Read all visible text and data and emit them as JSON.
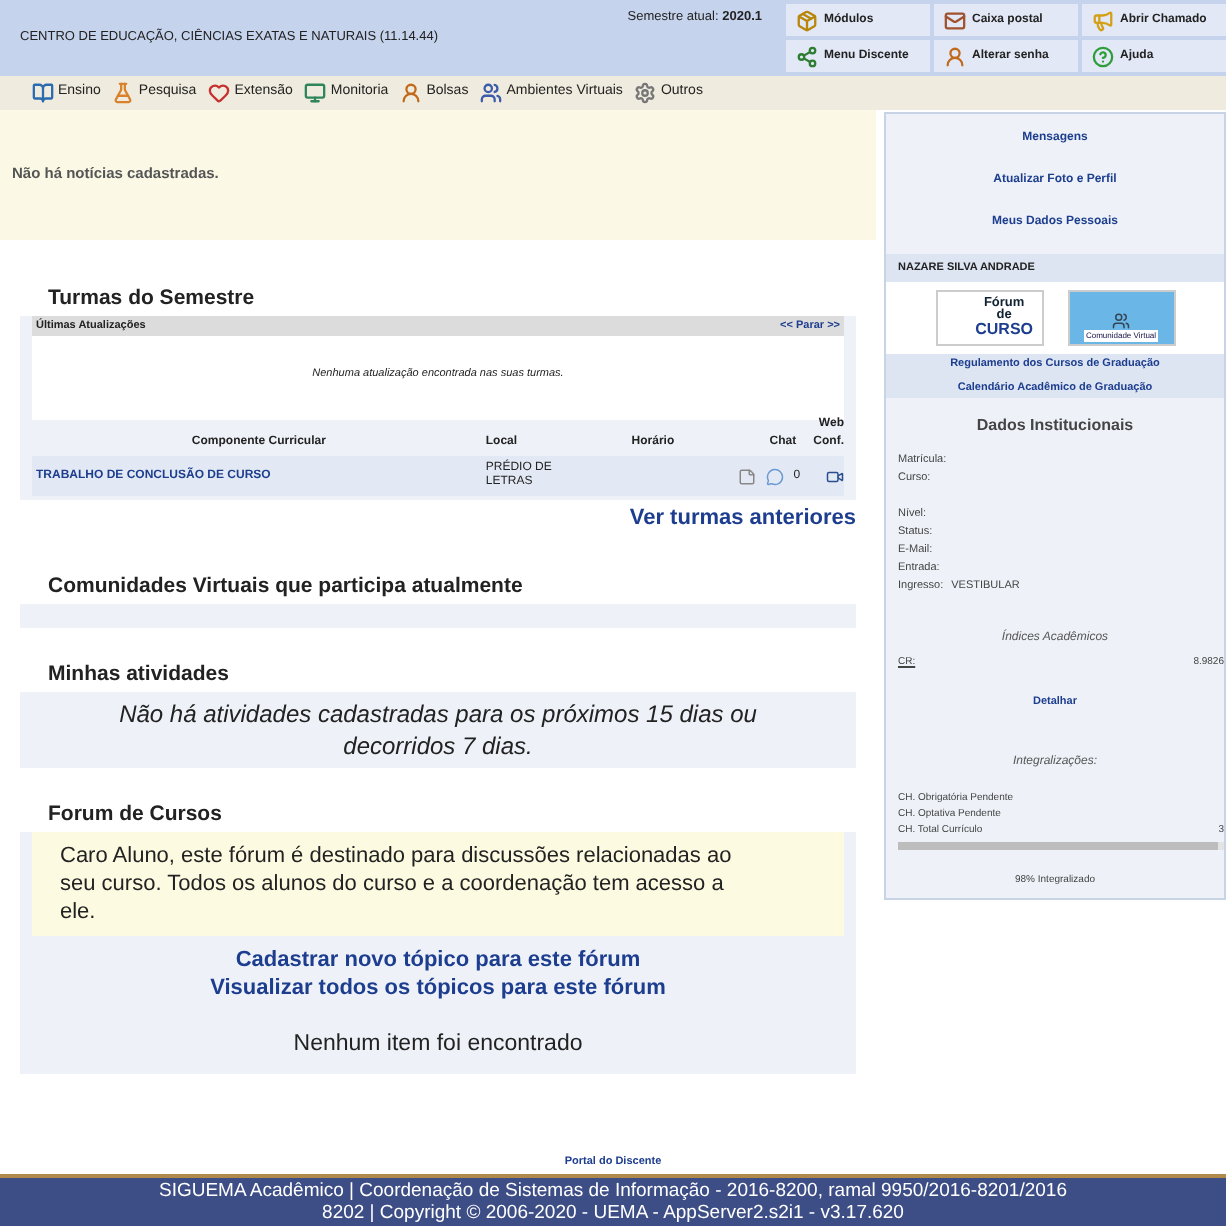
{
  "header": {
    "unit": "CENTRO DE EDUCAÇÃO, CIÊNCIAS EXATAS E NATURAIS (11.14.44)",
    "semester_label": "Semestre atual:",
    "semester": "2020.1",
    "shortcuts": [
      {
        "label": "Módulos",
        "kind": "box"
      },
      {
        "label": "Caixa postal",
        "kind": "mail"
      },
      {
        "label": "Abrir Chamado",
        "kind": "ticket"
      },
      {
        "label": "Menu Discente",
        "kind": "share"
      },
      {
        "label": "Alterar senha",
        "kind": "user"
      },
      {
        "label": "Ajuda",
        "kind": "help"
      }
    ]
  },
  "menu": [
    {
      "label": "Ensino",
      "kind": "book"
    },
    {
      "label": "Pesquisa",
      "kind": "flask"
    },
    {
      "label": "Extensão",
      "kind": "heart"
    },
    {
      "label": "Monitoria",
      "kind": "monitor"
    },
    {
      "label": "Bolsas",
      "kind": "user"
    },
    {
      "label": "Ambientes Virtuais",
      "kind": "users"
    },
    {
      "label": "Outros",
      "kind": "gear"
    }
  ],
  "notices": "Não há notícias cadastradas.",
  "classes": {
    "title": "Turmas do Semestre",
    "updates_label": "Últimas Atualizações",
    "stop": "<< Parar >>",
    "updates_empty": "Nenhuma atualização encontrada nas suas turmas.",
    "columns": [
      "Componente Curricular",
      "Local",
      "Horário",
      "Chat",
      "Web Conf."
    ],
    "rows": [
      {
        "name": "TRABALHO DE CONCLUSÃO DE CURSO",
        "local": "PRÉDIO DE LETRAS",
        "schedule": "",
        "chat_count": "0"
      }
    ],
    "previous": "Ver turmas anteriores"
  },
  "communities": {
    "title": "Comunidades Virtuais que participa atualmente"
  },
  "activities": {
    "title": "Minhas atividades",
    "empty": "Não há atividades cadastradas para os próximos 15 dias ou decorridos 7 dias."
  },
  "forum": {
    "title": "Forum de Cursos",
    "notice": "Caro Aluno, este fórum é destinado para discussões relacionadas ao seu curso. Todos os alunos do curso e a coordenação tem acesso a ele.",
    "links": [
      "Cadastrar novo tópico para este fórum",
      "Visualizar todos os tópicos para este fórum"
    ],
    "empty": "Nenhum item foi encontrado"
  },
  "sidebar": {
    "links": [
      "Mensagens",
      "Atualizar Foto e Perfil",
      "Meus Dados Pessoais"
    ],
    "student": "NAZARE SILVA ANDRADE",
    "banners": [
      {
        "kind": "forum",
        "lines": [
          "Fórum",
          "de",
          "CURSO"
        ]
      },
      {
        "kind": "community",
        "lines": [
          "Comunidade Virtual"
        ]
      }
    ],
    "doc_links": [
      "Regulamento dos Cursos de Graduação",
      "Calendário Acadêmico de Graduação"
    ],
    "institutional_title": "Dados Institucionais",
    "fields": [
      {
        "kind": "field",
        "label": "Matrícula:"
      },
      {
        "kind": "field",
        "label": "Curso:"
      },
      {
        "kind": "spacer"
      },
      {
        "kind": "field",
        "label": "Nível:"
      },
      {
        "kind": "field",
        "label": "Status:"
      },
      {
        "kind": "field",
        "label": "E-Mail:"
      },
      {
        "kind": "field",
        "label": "Entrada:"
      },
      {
        "kind": "field",
        "label": "Ingresso:",
        "value": "VESTIBULAR"
      }
    ],
    "indices_title": "Índices Acadêmicos",
    "cr_label": "CR:",
    "cr_value": "8.9826",
    "detail": "Detalhar",
    "integration_title": "Integralizações:",
    "ch": [
      {
        "label": "CH. Obrigatória Pendente"
      },
      {
        "label": "CH. Optativa Pendente"
      },
      {
        "label": "CH. Total Currículo",
        "value": "3"
      }
    ],
    "progress": {
      "level": 0.98,
      "label": "98% Integralizado"
    }
  },
  "footer": {
    "portal": "Portal do Discente",
    "lines": [
      "SIGUEMA Acadêmico | Coordenação de Sistemas de Informação - 2016-8200, ramal 9950/2016-8201/2016",
      "8202 | Copyright © 2006-2020 - UEMA - AppServer2.s2i1 - v3.17.620"
    ]
  }
}
